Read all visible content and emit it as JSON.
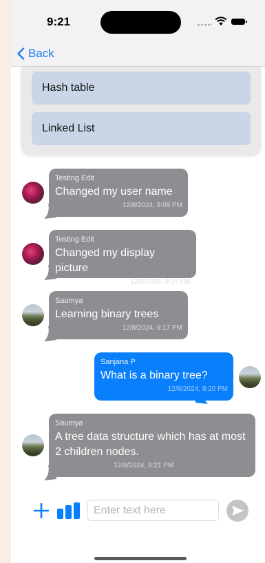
{
  "status": {
    "time": "9:21"
  },
  "nav": {
    "back_label": "Back"
  },
  "poll": {
    "options": [
      "Hash table",
      "Linked List"
    ]
  },
  "messages": [
    {
      "sender": "Testing Edit",
      "text": "Changed my user name",
      "time": "12/8/2024, 9:09 PM",
      "avatar": "flower-avatar"
    },
    {
      "sender": "Testing Edit",
      "text": "Changed my display picture",
      "time": "12/8/2024, 9:15 PM",
      "avatar": "flower-avatar"
    },
    {
      "sender": "Saumya",
      "text": "Learning binary trees",
      "time": "12/8/2024, 9:17 PM",
      "avatar": "mountain-avatar"
    },
    {
      "sender": "Sanjana P",
      "text": "What is a binary tree?",
      "time": "12/8/2024, 9:20 PM",
      "avatar": "mountain-avatar"
    },
    {
      "sender": "Saumya",
      "text": "A tree data structure which has at most 2 children nodes.",
      "time": "12/8/2024, 9:21 PM",
      "avatar": "mountain-avatar"
    }
  ],
  "composer": {
    "placeholder": "Enter text here"
  },
  "colors": {
    "accent": "#0a7ffb",
    "incoming_bubble": "#8e8e92",
    "poll_option": "#cad6e6"
  }
}
